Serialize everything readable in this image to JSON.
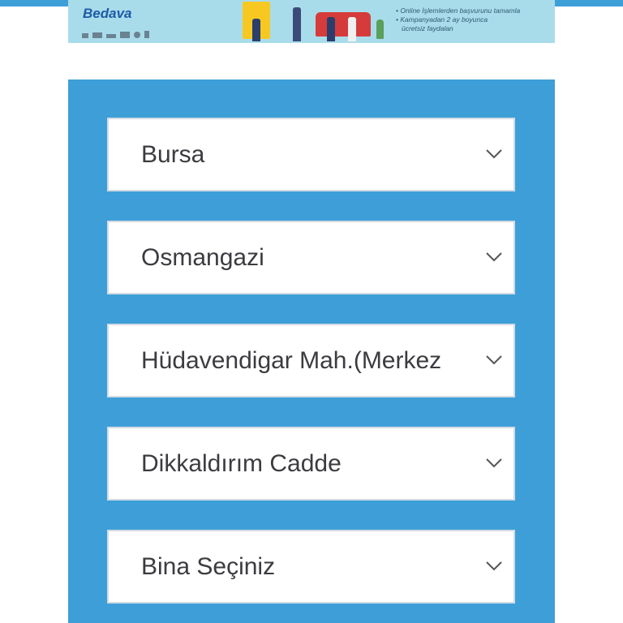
{
  "banner": {
    "brand": "Bedava",
    "bullets": [
      "• Online İşlemlerden başvurunu tamamla",
      "• Kampanyadan 2 ay boyunca",
      "ücretsiz faydalan"
    ]
  },
  "form": {
    "selects": [
      {
        "value": "Bursa"
      },
      {
        "value": "Osmangazi"
      },
      {
        "value": "Hüdavendigar Mah.(Merkez"
      },
      {
        "value": "Dikkaldırım Cadde"
      },
      {
        "value": "Bina Seçiniz"
      }
    ]
  },
  "colors": {
    "panel": "#3e9fd8",
    "banner": "#a9dcea",
    "text": "#3b3b40"
  }
}
